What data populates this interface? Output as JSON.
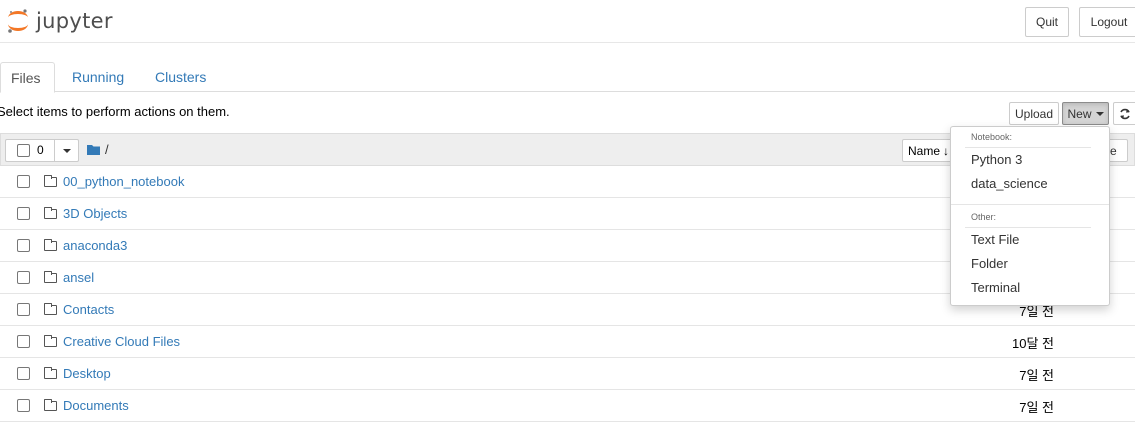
{
  "header": {
    "logo_text": "jupyter",
    "quit_label": "Quit",
    "logout_label": "Logout"
  },
  "tabs": [
    {
      "label": "Files",
      "active": true
    },
    {
      "label": "Running",
      "active": false
    },
    {
      "label": "Clusters",
      "active": false
    }
  ],
  "toolbar": {
    "hint": "Select items to perform actions on them.",
    "upload_label": "Upload",
    "new_label": "New",
    "refresh_icon": "refresh-icon"
  },
  "list_header": {
    "selected_count": "0",
    "breadcrumb": "/",
    "sort_label": "Name",
    "sort_icon": "arrow-down-icon",
    "hidden_col_fragment": "e"
  },
  "files": [
    {
      "name": "00_python_notebook",
      "modified": ""
    },
    {
      "name": "3D Objects",
      "modified": ""
    },
    {
      "name": "anaconda3",
      "modified": ""
    },
    {
      "name": "ansel",
      "modified": ""
    },
    {
      "name": "Contacts",
      "modified": "7일 전"
    },
    {
      "name": "Creative Cloud Files",
      "modified": "10달 전"
    },
    {
      "name": "Desktop",
      "modified": "7일 전"
    },
    {
      "name": "Documents",
      "modified": "7일 전"
    }
  ],
  "new_menu": {
    "notebook_header": "Notebook:",
    "notebook_items": [
      "Python 3",
      "data_science"
    ],
    "other_header": "Other:",
    "other_items": [
      "Text File",
      "Folder",
      "Terminal"
    ]
  },
  "colors": {
    "link": "#337ab7",
    "logo_orange": "#f37726",
    "logo_gray": "#767677"
  }
}
